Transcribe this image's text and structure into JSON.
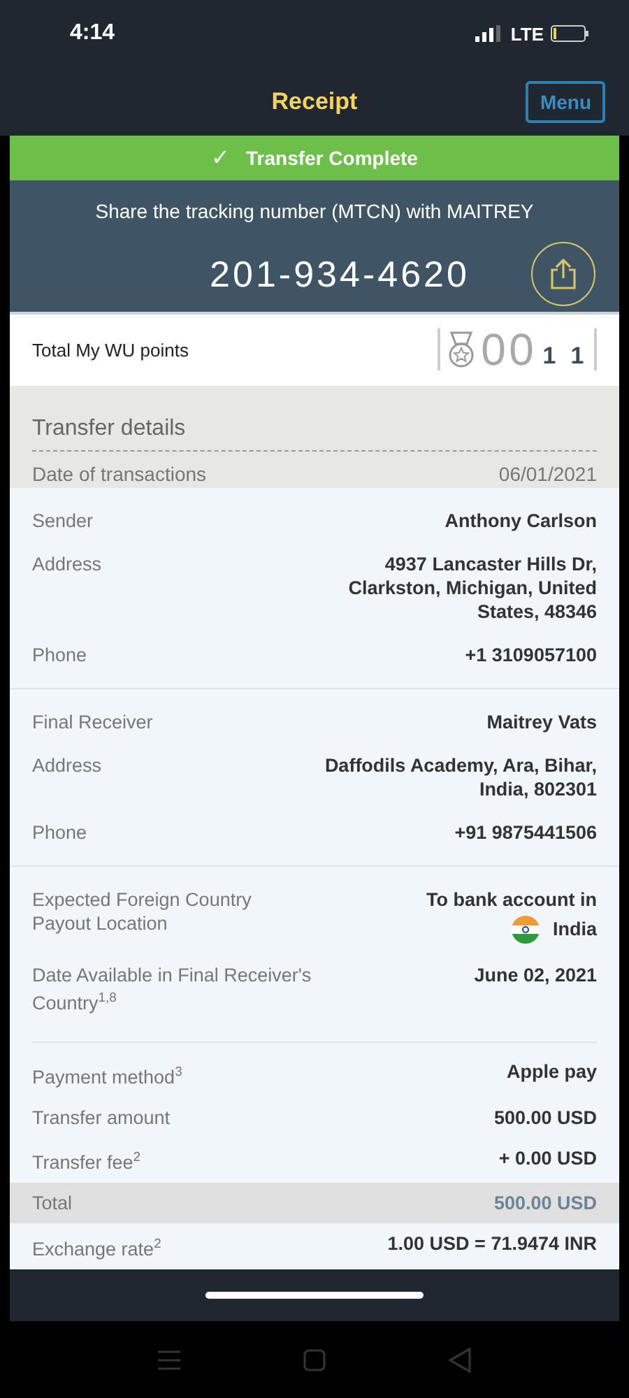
{
  "status_bar": {
    "time": "4:14",
    "network": "LTE"
  },
  "header": {
    "title": "Receipt",
    "menu_button": "Menu"
  },
  "banner": {
    "icon": "✓",
    "text": "Transfer Complete"
  },
  "tracking": {
    "message": "Share the tracking number (MTCN) with MAITREY",
    "number": "201-934-4620"
  },
  "points": {
    "label": "Total My WU points",
    "digits": [
      {
        "text": "0",
        "active": false
      },
      {
        "text": "0",
        "active": false
      },
      {
        "text": "1",
        "active": true
      },
      {
        "text": "1",
        "active": true
      }
    ]
  },
  "details": {
    "title": "Transfer details",
    "date_label": "Date of transactions",
    "date_value": "06/01/2021"
  },
  "sections": [
    {
      "rows": [
        {
          "kind": "text",
          "label": "Sender",
          "value": "Anthony Carlson"
        },
        {
          "kind": "text",
          "label": "Address",
          "value": "4937 Lancaster Hills Dr, Clarkston, Michigan, United States, 48346"
        },
        {
          "kind": "text",
          "label": "Phone",
          "value": "+1 3109057100"
        }
      ]
    },
    {
      "rows": [
        {
          "kind": "text",
          "label": "Final Receiver",
          "value": "Maitrey Vats"
        },
        {
          "kind": "text",
          "label": "Address",
          "value": "Daffodils Academy, Ara, Bihar, India, 802301"
        },
        {
          "kind": "text",
          "label": "Phone",
          "value": "+91 9875441506"
        }
      ]
    },
    {
      "rows": [
        {
          "kind": "flag",
          "label": "Expected Foreign Country Payout Location",
          "value": "To bank account in",
          "country": "India"
        },
        {
          "kind": "text",
          "label": "Date Available in Final Receiver's Country$^{1,8}$",
          "value": "June 02, 2021"
        }
      ]
    },
    {
      "rows": [
        {
          "kind": "text",
          "label": "Payment method$^{3}$",
          "value": "Apple pay",
          "highlight": false
        },
        {
          "kind": "text",
          "label": "Transfer amount",
          "value": "500.00 USD",
          "highlight": false
        },
        {
          "kind": "text",
          "label": "Transfer fee$^{2}$",
          "value": "+ 0.00 USD",
          "highlight": false
        },
        {
          "kind": "text",
          "label": "Total",
          "value": "500.00 USD",
          "highlight": true
        },
        {
          "kind": "text",
          "label": "Exchange rate$^{2}$",
          "value": "1.00 USD = 71.9474 INR",
          "highlight": false
        }
      ]
    }
  ]
}
